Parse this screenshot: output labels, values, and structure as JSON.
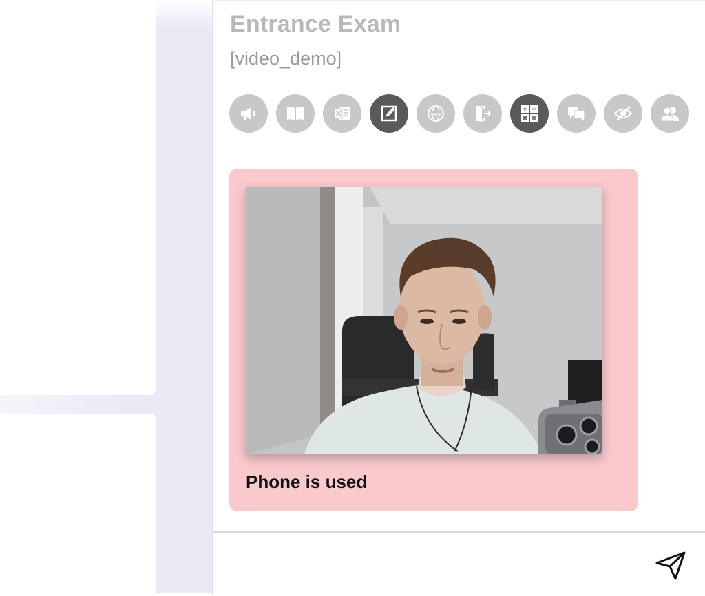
{
  "exam": {
    "title": "Entrance Exam",
    "subtitle": "[video_demo]"
  },
  "toolbar": {
    "tools": [
      {
        "icon": "megaphone-icon",
        "active": false
      },
      {
        "icon": "book-icon",
        "active": false
      },
      {
        "icon": "spreadsheet-icon",
        "active": false
      },
      {
        "icon": "edit-icon",
        "active": true
      },
      {
        "icon": "web-icon",
        "active": false
      },
      {
        "icon": "exit-icon",
        "active": false
      },
      {
        "icon": "calculator-icon",
        "active": true
      },
      {
        "icon": "chat-icon",
        "active": false
      },
      {
        "icon": "eye-slash-icon",
        "active": false
      },
      {
        "icon": "users-icon",
        "active": false
      }
    ]
  },
  "alert": {
    "caption": "Phone is used",
    "color": "#f9c9cc"
  }
}
